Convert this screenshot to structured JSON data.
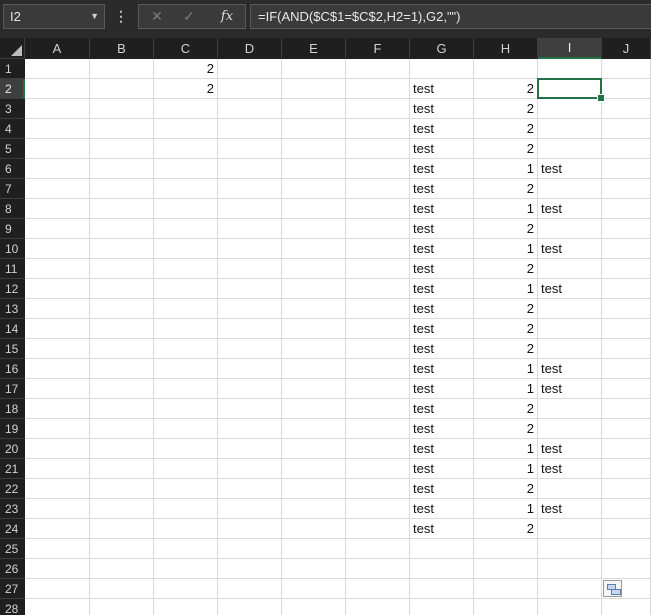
{
  "formula_bar": {
    "name_box": "I2",
    "formula": "=IF(AND($C$1=$C$2,H2=1),G2,\"\")",
    "cancel_glyph": "✕",
    "enter_glyph": "✓",
    "fx_glyph": "fx"
  },
  "columns": [
    "A",
    "B",
    "C",
    "D",
    "E",
    "F",
    "G",
    "H",
    "I",
    "J"
  ],
  "rows": [
    "1",
    "2",
    "3",
    "4",
    "5",
    "6",
    "7",
    "8",
    "9",
    "10",
    "11",
    "12",
    "13",
    "14",
    "15",
    "16",
    "17",
    "18",
    "19",
    "20",
    "21",
    "22",
    "23",
    "24",
    "25",
    "26",
    "27",
    "28"
  ],
  "selected_cell": "I2",
  "cells": {
    "C1": "2",
    "C2": "2",
    "G2": "test",
    "H2": "2",
    "G3": "test",
    "H3": "2",
    "G4": "test",
    "H4": "2",
    "G5": "test",
    "H5": "2",
    "G6": "test",
    "H6": "1",
    "I6": "test",
    "G7": "test",
    "H7": "2",
    "G8": "test",
    "H8": "1",
    "I8": "test",
    "G9": "test",
    "H9": "2",
    "G10": "test",
    "H10": "1",
    "I10": "test",
    "G11": "test",
    "H11": "2",
    "G12": "test",
    "H12": "1",
    "I12": "test",
    "G13": "test",
    "H13": "2",
    "G14": "test",
    "H14": "2",
    "G15": "test",
    "H15": "2",
    "G16": "test",
    "H16": "1",
    "I16": "test",
    "G17": "test",
    "H17": "1",
    "I17": "test",
    "G18": "test",
    "H18": "2",
    "G19": "test",
    "H19": "2",
    "G20": "test",
    "H20": "1",
    "I20": "test",
    "G21": "test",
    "H21": "1",
    "I21": "test",
    "G22": "test",
    "H22": "2",
    "G23": "test",
    "H23": "1",
    "I23": "test",
    "G24": "test",
    "H24": "2"
  },
  "numeric_columns": [
    "C",
    "H"
  ],
  "colors": {
    "selection": "#217346",
    "header_bg": "#1f1f1f",
    "gridline": "#dadada"
  }
}
